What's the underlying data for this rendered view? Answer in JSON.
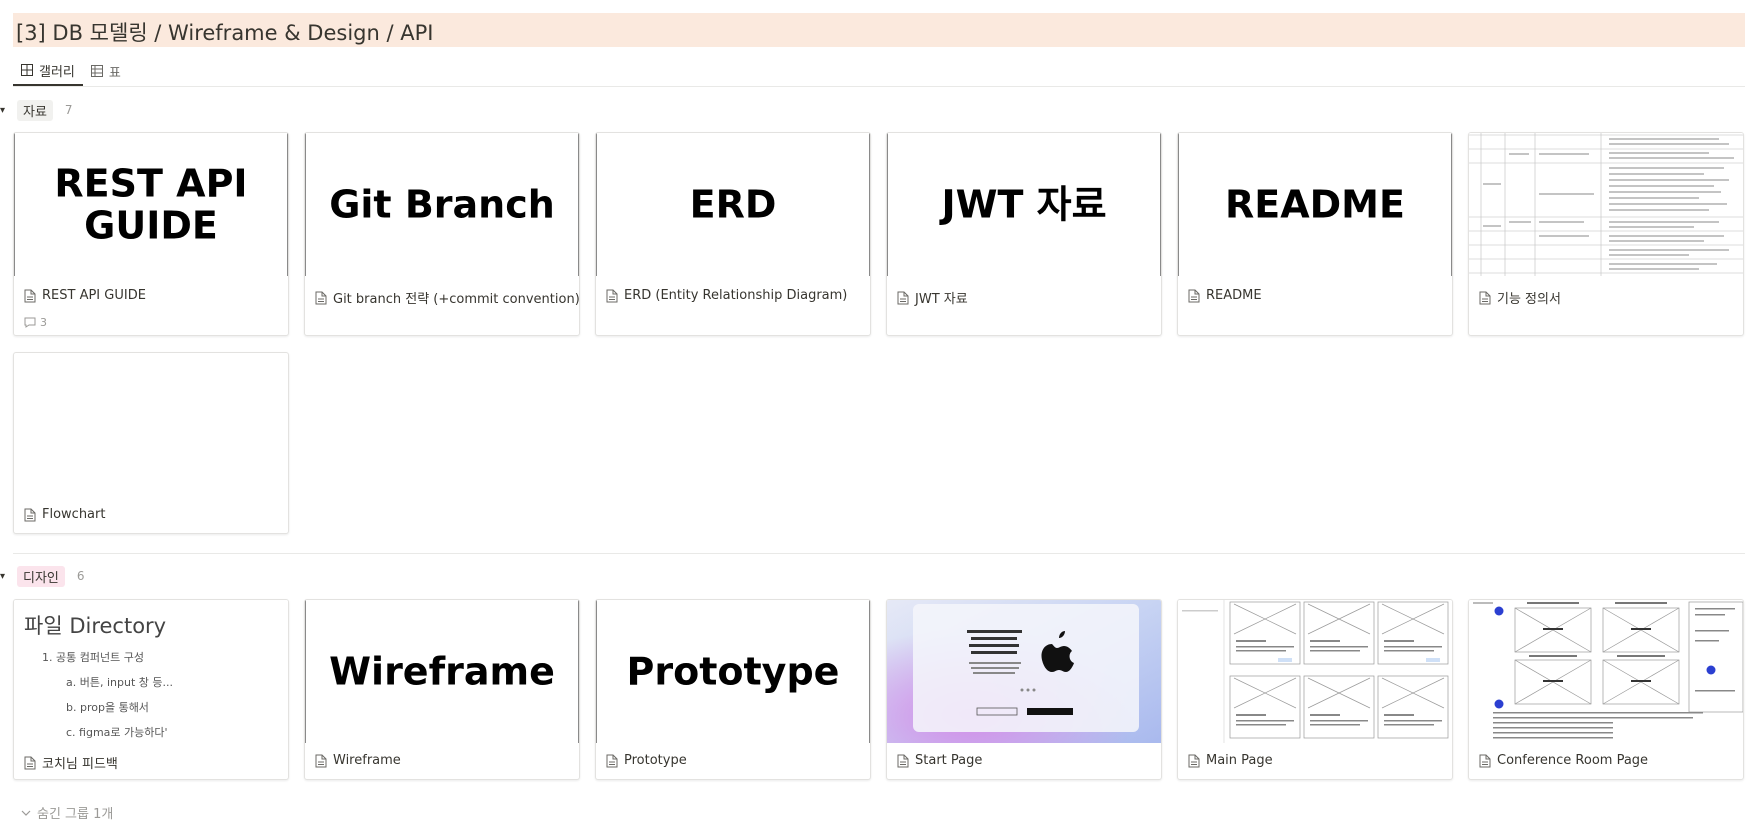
{
  "page": {
    "title": "[3] DB 모델링 / Wireframe & Design / API"
  },
  "views": [
    {
      "label": "갤러리",
      "icon": "gallery-icon",
      "active": true
    },
    {
      "label": "표",
      "icon": "table-icon",
      "active": false
    }
  ],
  "groups": [
    {
      "label": "자료",
      "count": "7",
      "pill_color": "#f1f1ef",
      "cards": [
        {
          "title": "REST API GUIDE",
          "cover_text": "REST API\nGUIDE",
          "comments": "3"
        },
        {
          "title": "Git branch 전략 (+commit convention)",
          "cover_text": "Git Branch"
        },
        {
          "title": "ERD (Entity Relationship Diagram)",
          "cover_text": "ERD"
        },
        {
          "title": "JWT 자료",
          "cover_text": "JWT 자료"
        },
        {
          "title": "README",
          "cover_text": "README"
        },
        {
          "title": "기능 정의서",
          "cover_text": ""
        },
        {
          "title": "Flowchart",
          "cover_text": ""
        }
      ]
    },
    {
      "label": "디자인",
      "count": "6",
      "pill_color": "#fbe4ec",
      "cards": [
        {
          "title": "코치님 피드백",
          "cover_title": "파일 Directory",
          "cover_items": [
            "1.  공통 컴퍼넌트 구성",
            "a.  버튼, input 창 등...",
            "b.  prop을 통해서",
            "c.  figma로 가능하다'"
          ]
        },
        {
          "title": "Wireframe",
          "cover_text": "Wireframe"
        },
        {
          "title": "Prototype",
          "cover_text": "Prototype"
        },
        {
          "title": "Start Page",
          "cover_text": ""
        },
        {
          "title": "Main Page",
          "cover_text": ""
        },
        {
          "title": "Conference Room Page",
          "cover_text": ""
        }
      ]
    }
  ],
  "hidden_groups": {
    "label": "숨긴 그룹 1개"
  },
  "colors": {
    "title_bg": "#fbe9dd",
    "border": "#e3e2e0",
    "text": "#37352f",
    "muted": "#9b9a97"
  }
}
